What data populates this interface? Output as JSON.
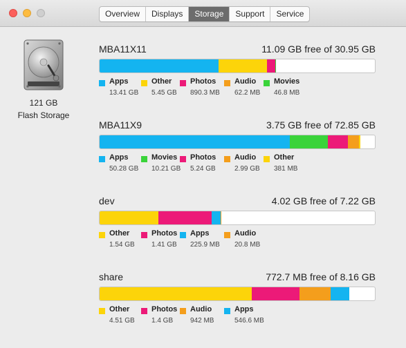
{
  "window": {
    "tabs": [
      {
        "label": "Overview",
        "active": false
      },
      {
        "label": "Displays",
        "active": false
      },
      {
        "label": "Storage",
        "active": true
      },
      {
        "label": "Support",
        "active": false
      },
      {
        "label": "Service",
        "active": false
      }
    ]
  },
  "disk": {
    "capacity": "121 GB",
    "type": "Flash Storage",
    "icon": "hard-drive-icon"
  },
  "colors": {
    "Apps": "#14b4f0",
    "Other": "#fcd40a",
    "Photos": "#ec1a78",
    "Audio": "#f49e1c",
    "Movies": "#3ad33a"
  },
  "volumes": [
    {
      "name": "MBA11X11",
      "free_text": "11.09 GB free of 30.95 GB",
      "segments": [
        {
          "label": "Apps",
          "size": "13.41 GB",
          "fraction": 0.433
        },
        {
          "label": "Other",
          "size": "5.45 GB",
          "fraction": 0.176
        },
        {
          "label": "Photos",
          "size": "890.3 MB",
          "fraction": 0.028
        },
        {
          "label": "Audio",
          "size": "62.2 MB",
          "fraction": 0.002
        },
        {
          "label": "Movies",
          "size": "46.8 MB",
          "fraction": 0.0015
        }
      ]
    },
    {
      "name": "MBA11X9",
      "free_text": "3.75 GB free of 72.85 GB",
      "segments": [
        {
          "label": "Apps",
          "size": "50.28 GB",
          "fraction": 0.69
        },
        {
          "label": "Movies",
          "size": "10.21 GB",
          "fraction": 0.14
        },
        {
          "label": "Photos",
          "size": "5.24 GB",
          "fraction": 0.072
        },
        {
          "label": "Audio",
          "size": "2.99 GB",
          "fraction": 0.041
        },
        {
          "label": "Other",
          "size": "381 MB",
          "fraction": 0.005
        }
      ]
    },
    {
      "name": "dev",
      "free_text": "4.02 GB free of 7.22 GB",
      "segments": [
        {
          "label": "Other",
          "size": "1.54 GB",
          "fraction": 0.213
        },
        {
          "label": "Photos",
          "size": "1.41 GB",
          "fraction": 0.195
        },
        {
          "label": "Apps",
          "size": "225.9 MB",
          "fraction": 0.031
        },
        {
          "label": "Audio",
          "size": "20.8 MB",
          "fraction": 0.003
        }
      ]
    },
    {
      "name": "share",
      "free_text": "772.7 MB free of 8.16 GB",
      "segments": [
        {
          "label": "Other",
          "size": "4.51 GB",
          "fraction": 0.553
        },
        {
          "label": "Photos",
          "size": "1.4 GB",
          "fraction": 0.172
        },
        {
          "label": "Audio",
          "size": "942 MB",
          "fraction": 0.115
        },
        {
          "label": "Apps",
          "size": "546.6 MB",
          "fraction": 0.067
        }
      ]
    }
  ]
}
